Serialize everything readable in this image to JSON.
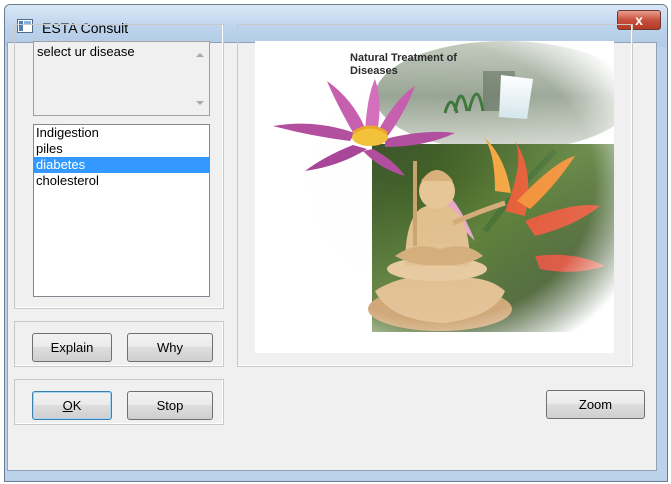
{
  "window": {
    "title": "ESTA Consult",
    "close_glyph": "x",
    "icons": {
      "app": "app-window-icon",
      "close": "close-icon"
    }
  },
  "prompt": {
    "text": "select ur disease"
  },
  "disease_list": {
    "items": [
      "Indigestion",
      "piles",
      "diabetes",
      "cholesterol"
    ],
    "selected": "diabetes"
  },
  "buttons": {
    "explain": "Explain",
    "why": "Why",
    "ok_mnemonic": "O",
    "ok_rest": "K",
    "stop": "Stop",
    "zoom": "Zoom"
  },
  "image": {
    "caption_line1": "Natural Treatment of",
    "caption_line2": "Diseases"
  },
  "colors": {
    "selection": "#3399ff",
    "titlebar": "#bcd3ec",
    "close_button": "#c8503c",
    "face": "#f0f0f0"
  }
}
